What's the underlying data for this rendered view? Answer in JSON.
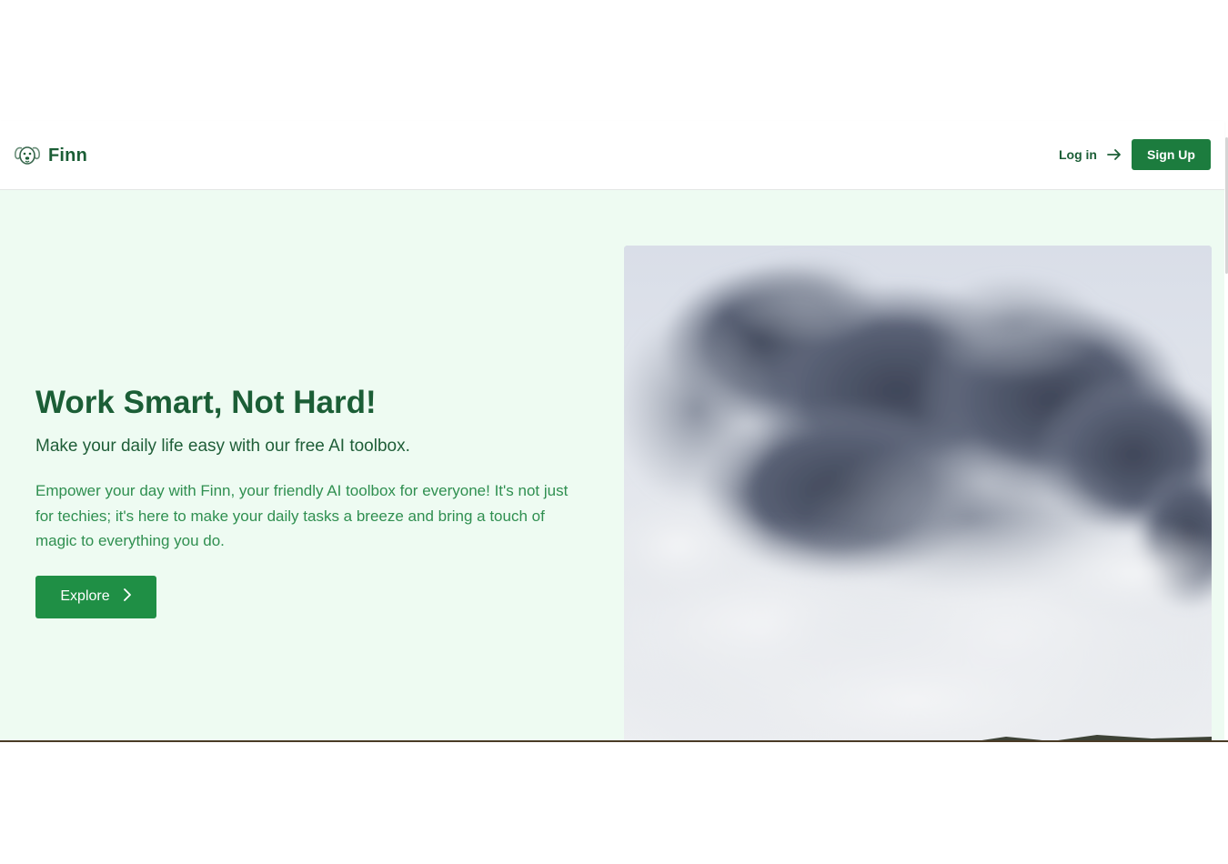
{
  "brand": {
    "name": "Finn",
    "logo_icon": "dog-face-icon"
  },
  "nav": {
    "login_label": "Log in",
    "login_icon": "arrow-right-icon",
    "signup_label": "Sign Up"
  },
  "hero": {
    "title": "Work Smart, Not Hard!",
    "subtitle": "Make your daily life easy with our free AI toolbox.",
    "description": "Empower your day with Finn, your friendly AI toolbox for everyone! It's not just for techies; it's here to make your daily tasks a breeze and bring a touch of magic to everything you do.",
    "explore_label": "Explore",
    "explore_icon": "chevron-right-icon",
    "image_subject": "volcanic smoke clouds"
  },
  "colors": {
    "primary": "#1c7c3e",
    "brand_text": "#1b5e36",
    "hero_background": "#eefbf2",
    "body_text": "#2f8f50"
  }
}
